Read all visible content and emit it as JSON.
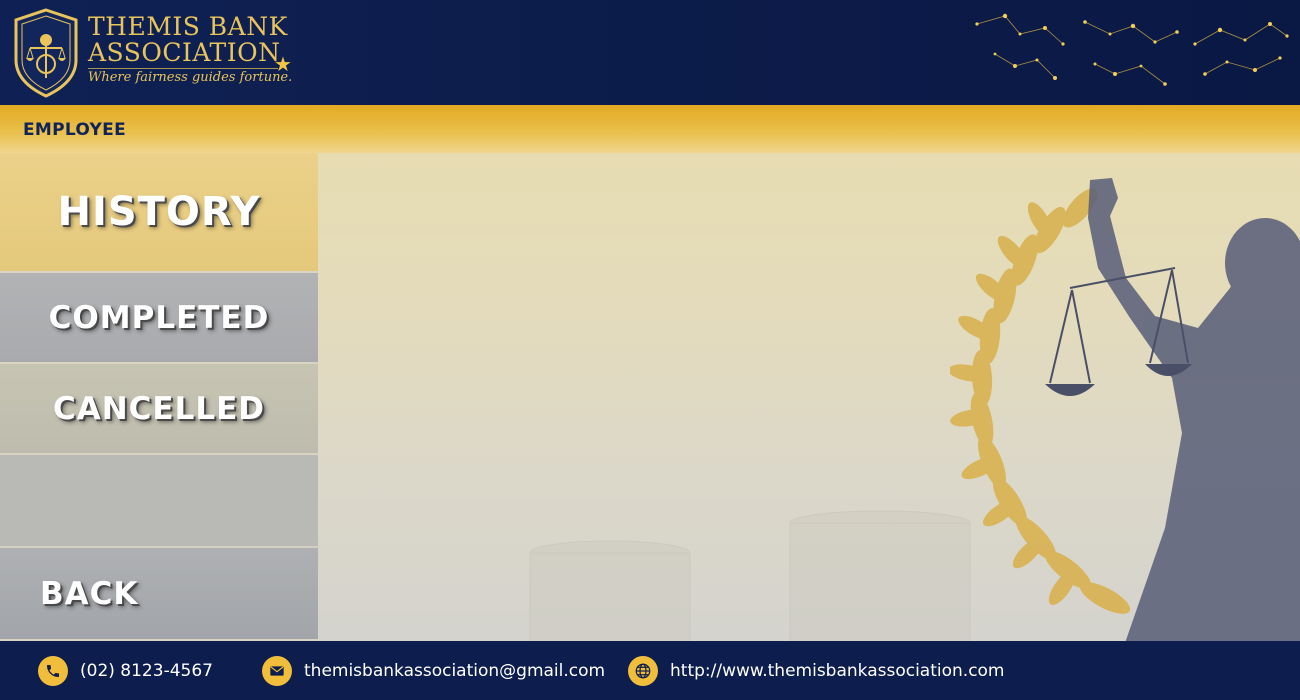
{
  "header": {
    "brand_line1": "THEMIS BANK",
    "brand_line2": "ASSOCIATION",
    "tagline": "Where fairness guides fortune."
  },
  "section": {
    "title": "EMPLOYEE"
  },
  "sidebar": {
    "items": [
      {
        "label": "HISTORY",
        "active": true
      },
      {
        "label": "COMPLETED",
        "active": false
      },
      {
        "label": "CANCELLED",
        "active": false
      }
    ],
    "back_label": "BACK"
  },
  "footer": {
    "phone": "(02) 8123-4567",
    "email": "themisbankassociation@gmail.com",
    "website": "http://www.themisbankassociation.com"
  },
  "colors": {
    "navy": "#0d1d4d",
    "gold": "#e9c45a",
    "accent_gold": "#f0be3b",
    "active_tab": "#ebd189"
  },
  "icons": [
    "scales-logo-icon",
    "star-icon",
    "constellation-graphic",
    "phone-icon",
    "mail-icon",
    "globe-icon"
  ]
}
